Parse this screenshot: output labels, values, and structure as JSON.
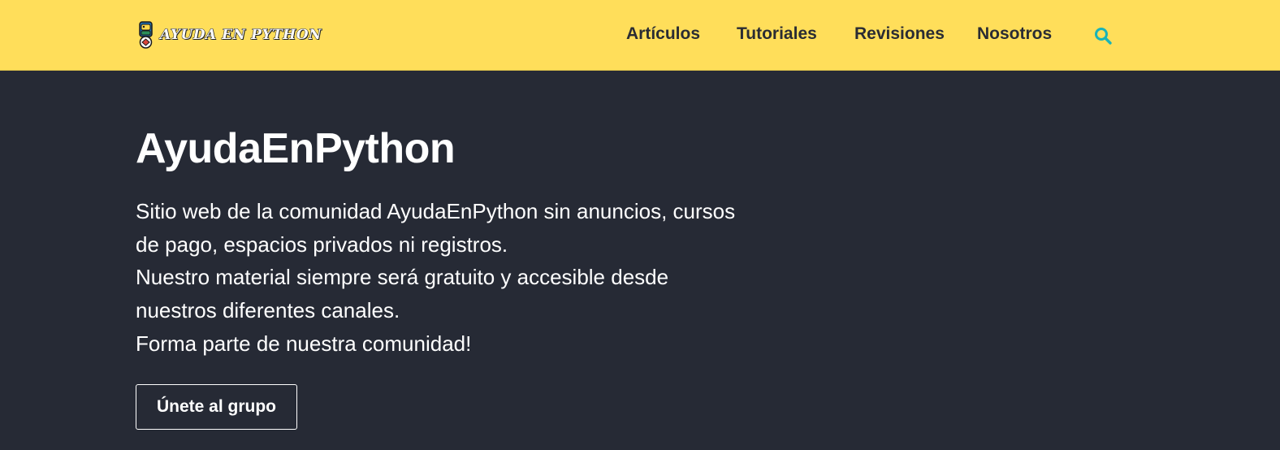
{
  "header": {
    "logo_text": "AYUDA EN PYTHON",
    "logo_icon": "python-logo-icon",
    "background_color": "#ffde5a",
    "nav_items": [
      {
        "label": "Artículos"
      },
      {
        "label": "Tutoriales"
      },
      {
        "label": "Revisiones"
      },
      {
        "label": "Nosotros"
      }
    ],
    "search_icon": "search-icon",
    "search_icon_color": "#19b3b8"
  },
  "hero": {
    "title": "AyudaEnPython",
    "lines": [
      "Sitio web de la comunidad AyudaEnPython sin anuncios, cursos",
      "de pago, espacios privados ni registros.",
      "Nuestro material siempre será gratuito y accesible desde",
      "nuestros diferentes canales.",
      "Forma parte de nuestra comunidad!"
    ],
    "button_label": "Únete al grupo",
    "background_color": "#262a35"
  }
}
